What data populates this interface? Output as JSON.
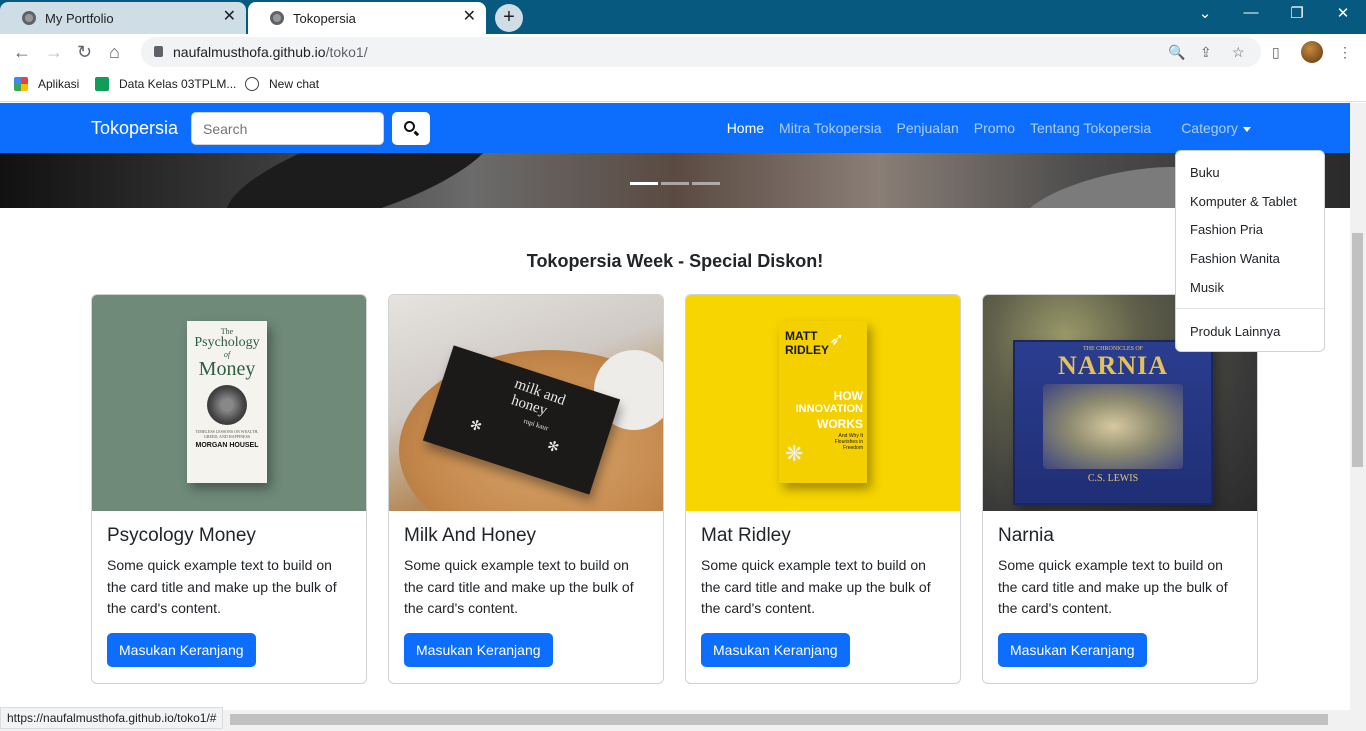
{
  "browser": {
    "tabs": [
      {
        "title": "My Portfolio",
        "active": false
      },
      {
        "title": "Tokopersia",
        "active": true
      }
    ],
    "url_host": "naufalmusthofa.github.io",
    "url_path": "/toko1/",
    "bookmarks": [
      {
        "label": "Aplikasi",
        "icon": "apps-grid-icon"
      },
      {
        "label": "Data Kelas 03TPLM...",
        "icon": "sheets-icon"
      },
      {
        "label": "New chat",
        "icon": "chatgpt-icon"
      }
    ],
    "status_url": "https://naufalmusthofa.github.io/toko1/#"
  },
  "navbar": {
    "brand": "Tokopersia",
    "search_placeholder": "Search",
    "links": [
      "Home",
      "Mitra Tokopersia",
      "Penjualan",
      "Promo",
      "Tentang Tokopersia"
    ],
    "active_link": "Home",
    "category_label": "Category",
    "accent": "#0d6efd"
  },
  "dropdown": {
    "items": [
      "Buku",
      "Komputer & Tablet",
      "Fashion Pria",
      "Fashion Wanita",
      "Musik"
    ],
    "extra": "Produk Lainnya"
  },
  "section": {
    "heading": "Tokopersia Week - Special Diskon!"
  },
  "cards": [
    {
      "title": "Psycology Money",
      "text": "Some quick example text to build on the card title and make up the bulk of the card's content.",
      "button": "Masukan Keranjang",
      "cover": {
        "l1": "The",
        "l2": "Psychology",
        "l3": "of",
        "l4": "Money",
        "sub": "TIMELESS LESSONS ON WEALTH, GREED, AND HAPPINESS",
        "author": "MORGAN HOUSEL"
      }
    },
    {
      "title": "Milk And Honey",
      "text": "Some quick example text to build on the card title and make up the bulk of the card's content.",
      "button": "Masukan Keranjang",
      "cover": {
        "l1": "milk and",
        "l2": "honey",
        "author": "rupi kaur"
      }
    },
    {
      "title": "Mat Ridley",
      "text": "Some quick example text to build on the card title and make up the bulk of the card's content.",
      "button": "Masukan Keranjang",
      "cover": {
        "author1": "MATT",
        "author2": "RIDLEY",
        "t1": "HOW",
        "t2": "INNOVATION",
        "t3": "WORKS",
        "sub": "And Why It Flourishes in Freedom"
      }
    },
    {
      "title": "Narnia",
      "text": "Some quick example text to build on the card title and make up the bulk of the card's content.",
      "button": "Masukan Keranjang",
      "cover": {
        "top": "THE CHRONICLES OF",
        "title": "NARNIA",
        "author": "C.S. LEWIS"
      }
    }
  ]
}
